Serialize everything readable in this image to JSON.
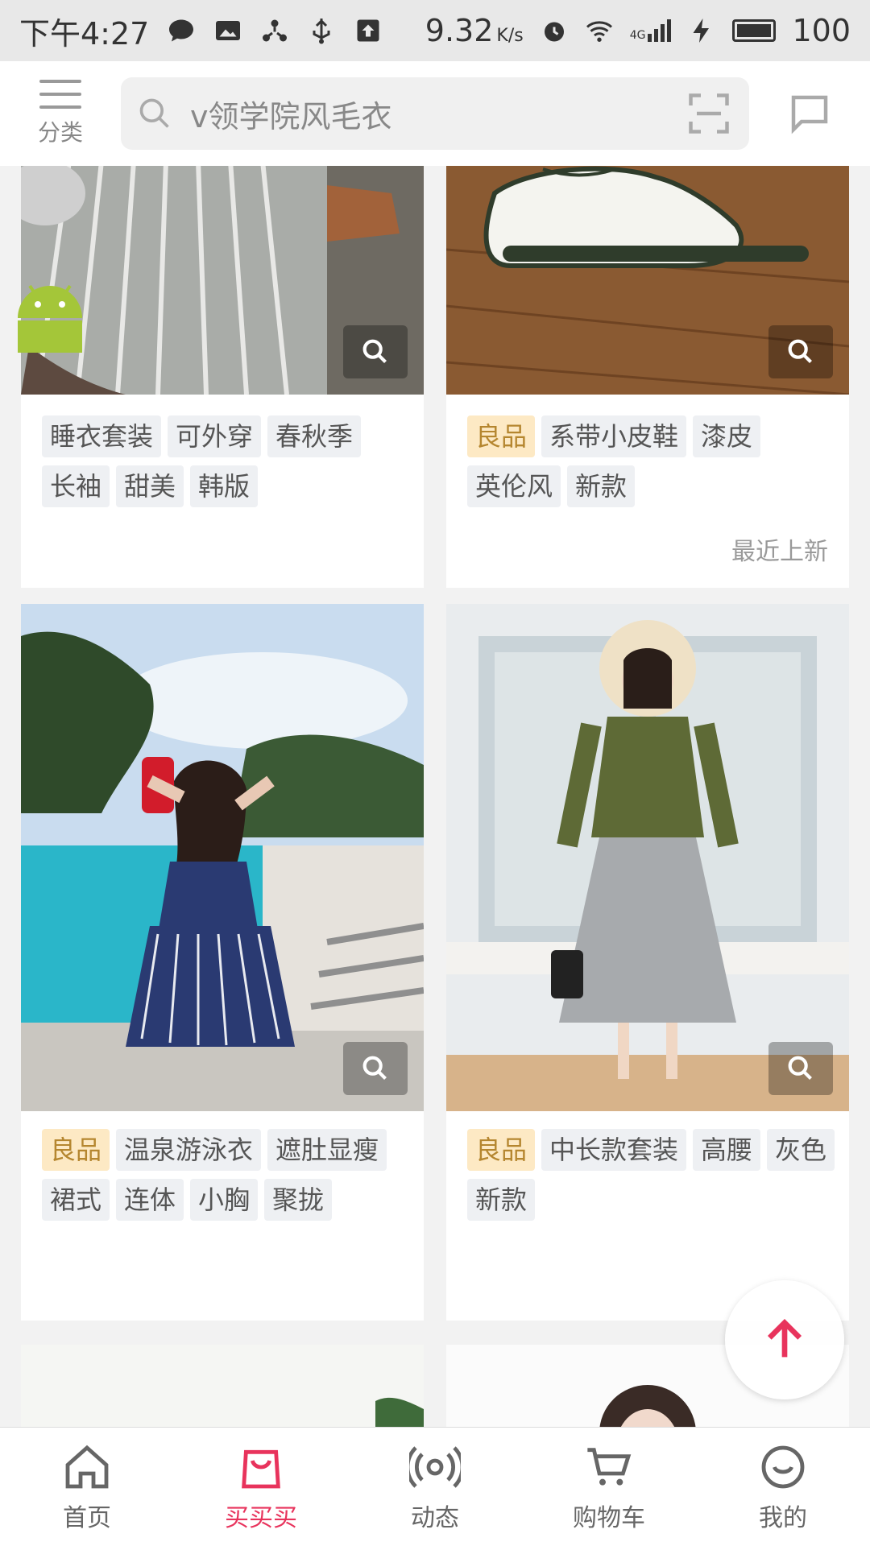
{
  "status_bar": {
    "time": "下午4:27",
    "speed": "9.32",
    "speed_unit": "K/s",
    "network": "4G",
    "battery": "100",
    "icons": [
      "chat-bubble-icon",
      "image-icon",
      "share-icon",
      "usb-icon",
      "upload-icon",
      "alarm-icon",
      "wifi-icon",
      "signal-icon",
      "charging-icon",
      "battery-icon"
    ]
  },
  "header": {
    "category_label": "分类",
    "search_placeholder": "v领学院风毛衣"
  },
  "products": [
    {
      "tags": [
        "睡衣套装",
        "可外穿",
        "春秋季",
        "长袖",
        "甜美",
        "韩版"
      ]
    },
    {
      "tags": [
        "良品",
        "系带小皮鞋",
        "漆皮",
        "英伦风",
        "新款"
      ],
      "sold_label": "最近上新"
    },
    {
      "tags": [
        "良品",
        "温泉游泳衣",
        "遮肚显瘦",
        "裙式",
        "连体",
        "小胸",
        "聚拢"
      ]
    },
    {
      "tags": [
        "良品",
        "中长款套装",
        "高腰",
        "灰色",
        "新款"
      ]
    }
  ],
  "bottom_nav": [
    {
      "label": "首页",
      "icon": "home-icon"
    },
    {
      "label": "买买买",
      "icon": "shopping-bag-icon"
    },
    {
      "label": "动态",
      "icon": "broadcast-icon"
    },
    {
      "label": "购物车",
      "icon": "cart-icon"
    },
    {
      "label": "我的",
      "icon": "profile-icon"
    }
  ],
  "colors": {
    "accent": "#e8335c",
    "tag_good_bg": "#fde9c4",
    "tag_bg": "#eef0f3"
  }
}
